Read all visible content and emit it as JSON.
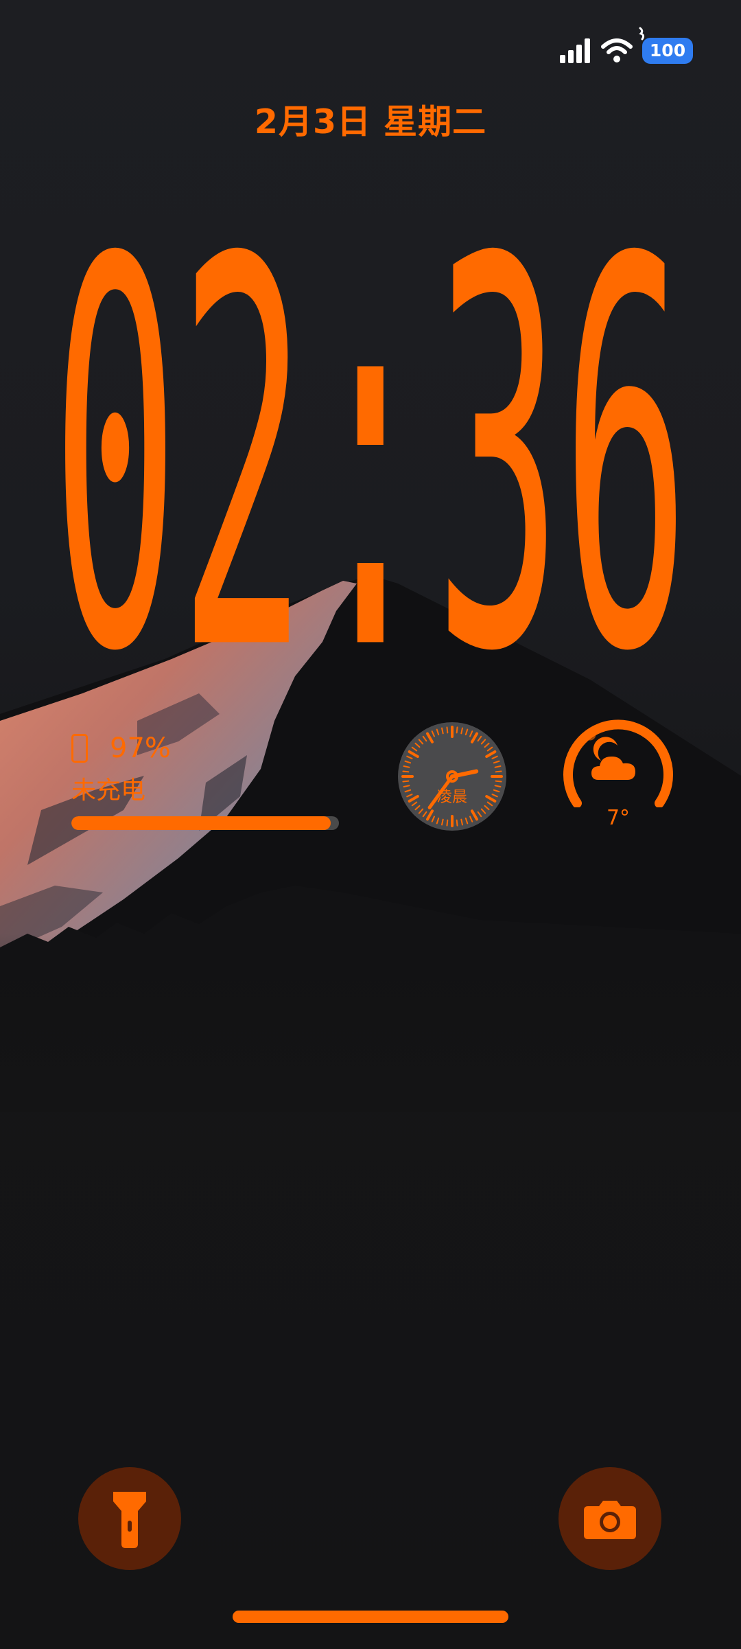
{
  "status_bar": {
    "battery_level": "100",
    "signal_icon": "cellular-signal-icon",
    "wifi_icon": "wifi-icon",
    "charging_icon": "charging-bolt-icon",
    "battery_color": "#2f7cf0"
  },
  "lock_screen": {
    "date": "2月3日 星期二",
    "time": "02:36",
    "accent_color": "#ff6a00"
  },
  "widgets": {
    "battery": {
      "icon": "phone-icon",
      "percent_label": "97%",
      "percent_value": 97,
      "status": "未充电"
    },
    "analog_clock": {
      "period_label": "凌晨",
      "hour": 2,
      "minute": 36
    },
    "weather": {
      "icon": "partly-cloudy-night-icon",
      "temperature": "7°"
    }
  },
  "quick_actions": {
    "left": {
      "icon": "flashlight-icon"
    },
    "right": {
      "icon": "camera-icon"
    }
  }
}
